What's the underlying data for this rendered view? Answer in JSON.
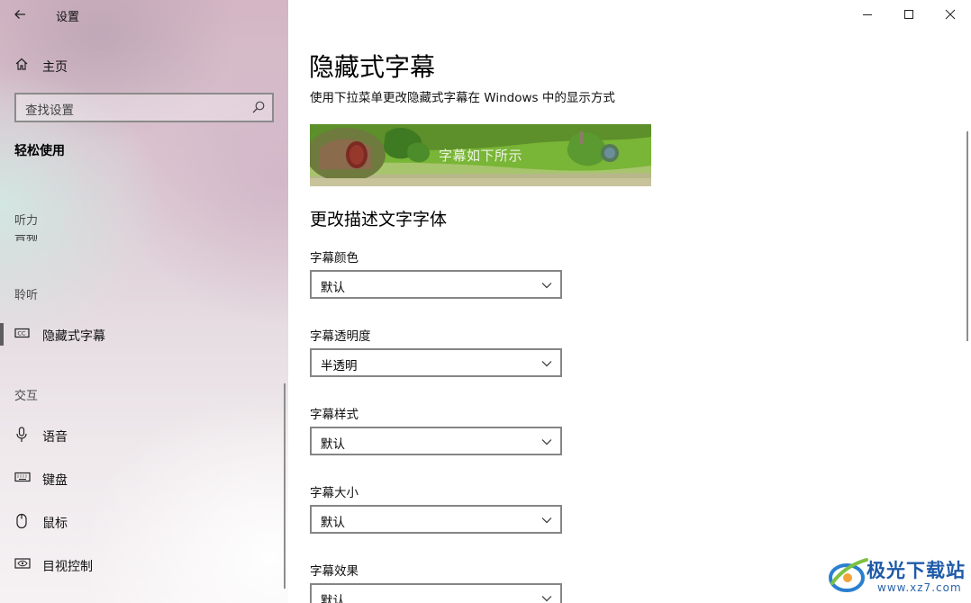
{
  "window": {
    "app_title": "设置",
    "controls": [
      "minimize",
      "maximize",
      "close"
    ]
  },
  "sidebar": {
    "home_label": "主页",
    "search_placeholder": "查找设置",
    "category": "轻松使用",
    "section_hearing_top": "听力",
    "clipped_item": "音频",
    "section_listening": "聆听",
    "active_item": "隐藏式字幕",
    "section_interaction": "交互",
    "items": [
      {
        "label": "语音",
        "icon": "microphone-icon"
      },
      {
        "label": "键盘",
        "icon": "keyboard-icon"
      },
      {
        "label": "鼠标",
        "icon": "mouse-icon"
      },
      {
        "label": "目视控制",
        "icon": "eye-control-icon"
      }
    ]
  },
  "main": {
    "title": "隐藏式字幕",
    "subtitle": "使用下拉菜单更改隐藏式字幕在 Windows 中的显示方式",
    "preview_caption": "字幕如下所示",
    "section_title": "更改描述文字字体",
    "fields": [
      {
        "label": "字幕颜色",
        "value": "默认"
      },
      {
        "label": "字幕透明度",
        "value": "半透明"
      },
      {
        "label": "字幕样式",
        "value": "默认"
      },
      {
        "label": "字幕大小",
        "value": "默认"
      },
      {
        "label": "字幕效果",
        "value": "默认"
      }
    ]
  },
  "watermark": {
    "text": "极光下载站",
    "url": "www.xz7.com"
  },
  "colors": {
    "accent_border": "#858585",
    "watermark_blue": "#1e5aa8"
  }
}
